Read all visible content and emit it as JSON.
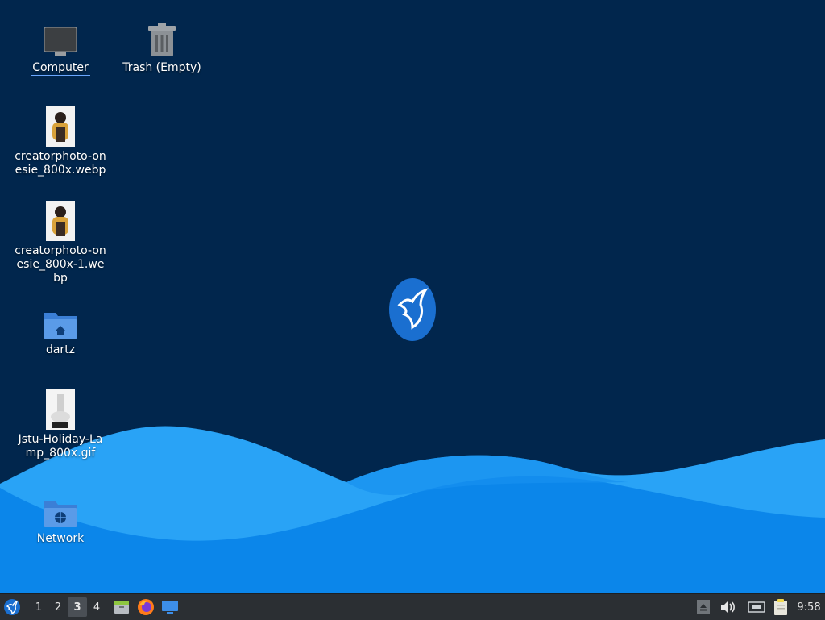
{
  "desktop": {
    "icons": [
      {
        "label": "Computer",
        "icon": "computer-icon"
      },
      {
        "label": "Trash (Empty)",
        "icon": "trash-icon"
      },
      {
        "label": "creatorphoto-onesie_800x.webp",
        "icon": "image-thumbnail-icon"
      },
      {
        "label": "creatorphoto-onesie_800x-1.webp",
        "icon": "image-thumbnail-icon"
      },
      {
        "label": "dartz",
        "icon": "home-folder-icon"
      },
      {
        "label": "Jstu-Holiday-Lamp_800x.gif",
        "icon": "image-thumbnail-icon"
      },
      {
        "label": "Network",
        "icon": "network-folder-icon"
      }
    ],
    "selected_icon": "Computer"
  },
  "taskbar": {
    "workspaces": [
      "1",
      "2",
      "3",
      "4"
    ],
    "active_workspace": "3",
    "launchers": [
      "file-manager-icon",
      "firefox-icon",
      "show-desktop-icon"
    ],
    "tray": [
      "eject-icon",
      "volume-icon",
      "network-wired-icon",
      "clipboard-icon"
    ],
    "clock": "9:58"
  },
  "colors": {
    "background": "#01264d",
    "wave_light": "#1ea0f5",
    "wave_mid": "#0a82e6",
    "taskbar": "#2b2f33",
    "folder": "#4a8fe0"
  }
}
